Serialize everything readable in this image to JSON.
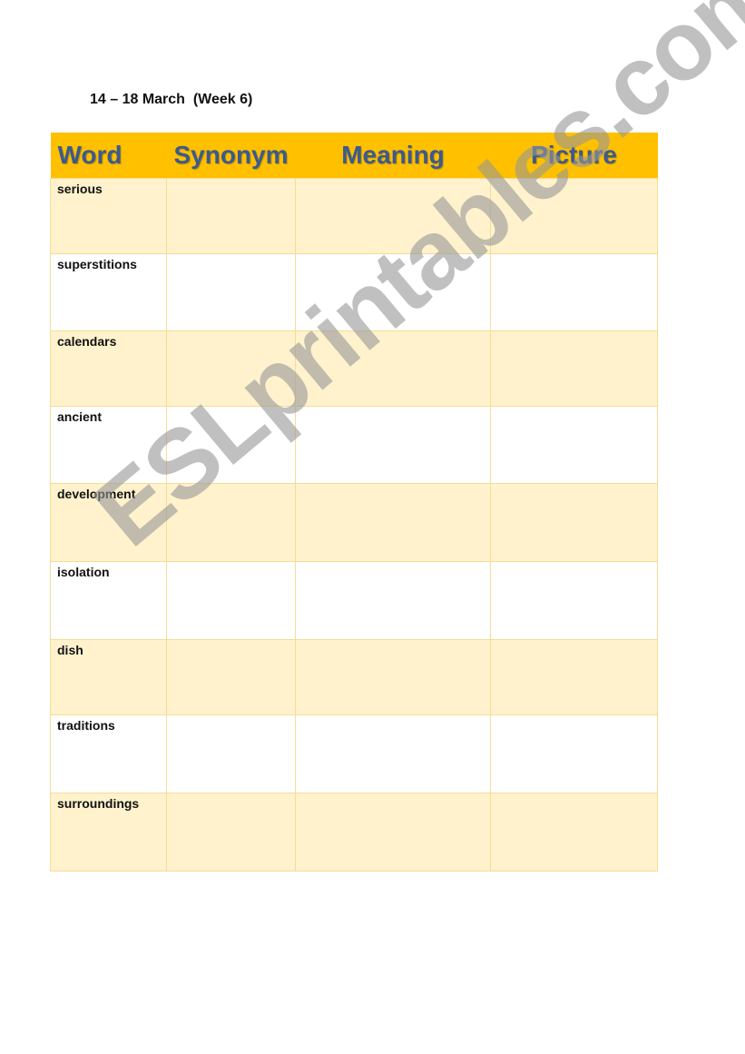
{
  "heading": "14 – 18 March  (Week 6)",
  "table": {
    "headers": [
      "Word",
      "Synonym",
      "Meaning",
      "Picture"
    ],
    "rows": [
      {
        "word": "serious"
      },
      {
        "word": "superstitions"
      },
      {
        "word": "calendars"
      },
      {
        "word": "ancient"
      },
      {
        "word": "development"
      },
      {
        "word": "isolation"
      },
      {
        "word": "dish"
      },
      {
        "word": "traditions"
      },
      {
        "word": "surroundings"
      }
    ]
  },
  "watermark": "ESLprintables.com"
}
